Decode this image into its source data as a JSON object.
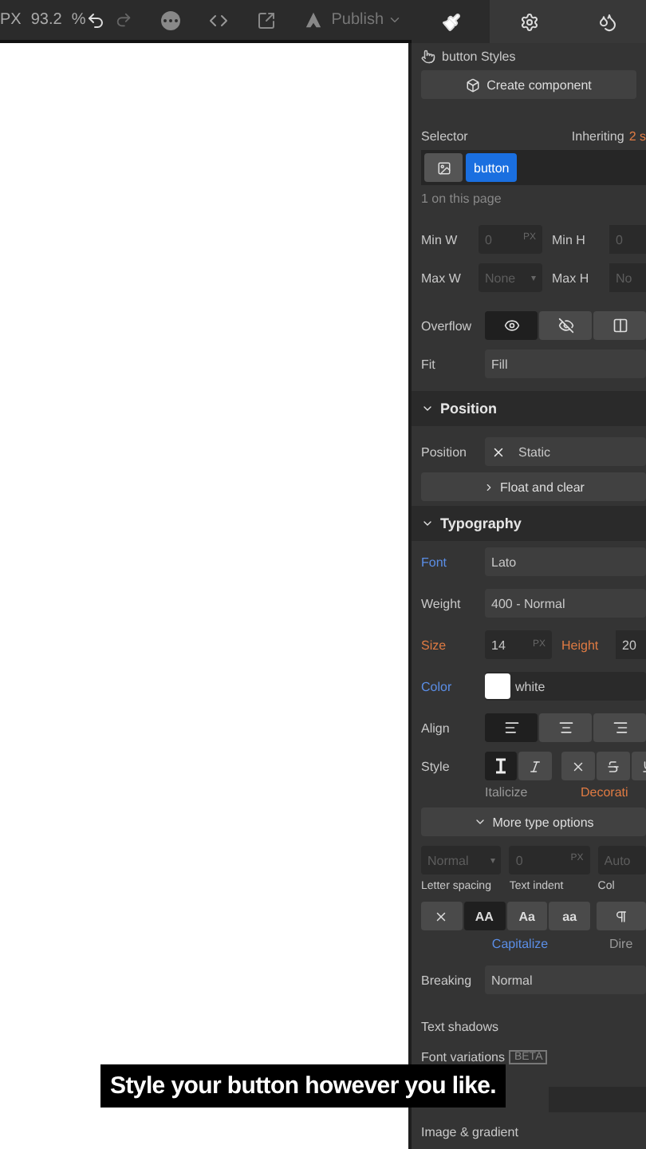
{
  "toolbar": {
    "unit": "PX",
    "zoom": "93.2",
    "percent": "%",
    "publish": "Publish"
  },
  "panel_tabs": [
    {
      "kind": "style",
      "selected": true
    },
    {
      "kind": "settings",
      "selected": false
    },
    {
      "kind": "interactions",
      "selected": false
    }
  ],
  "styles_header": "button Styles",
  "create_component": "Create component",
  "selector": {
    "label": "Selector",
    "inheriting": "Inheriting",
    "inheriting_count": "2 s",
    "tag": "button",
    "usage": "1 on this page"
  },
  "size_rows": [
    {
      "label": "Min W",
      "placeholder": "0",
      "unit": "PX",
      "label2": "Min H",
      "placeholder2": "0"
    },
    {
      "label": "Max W",
      "placeholder": "None",
      "unit": "▾",
      "label2": "Max H",
      "placeholder2": "No"
    }
  ],
  "overflow": {
    "label": "Overflow",
    "options": [
      {
        "kind": "visible",
        "selected": true
      },
      {
        "kind": "hidden",
        "selected": false
      },
      {
        "kind": "scroll",
        "selected": false
      }
    ]
  },
  "fit": {
    "label": "Fit",
    "value": "Fill"
  },
  "position_section": {
    "title": "Position",
    "expanded": true,
    "label": "Position",
    "value": "Static",
    "float": "Float and clear"
  },
  "typography": {
    "title": "Typography",
    "expanded": true,
    "rows": [
      {
        "kind": "select",
        "label": "Font",
        "color": "#5b8ee6",
        "value": "Lato"
      },
      {
        "kind": "select",
        "label": "Weight",
        "value": "400 - Normal"
      },
      {
        "kind": "size",
        "label": "Size",
        "color": "#e07b43",
        "value": "14",
        "unit": "PX",
        "second": {
          "label": "Height",
          "color": "#e07b43",
          "value": "20"
        }
      },
      {
        "kind": "color",
        "label": "Color",
        "color": "#5b8ee6",
        "value": "white",
        "swatch": {
          "color": "#ffffff"
        }
      }
    ],
    "align": {
      "label": "Align",
      "options": [
        {
          "kind": "left",
          "selected": true
        },
        {
          "kind": "center",
          "selected": false
        },
        {
          "kind": "right",
          "selected": false
        }
      ]
    },
    "style": {
      "label": "Style",
      "italic": [
        {
          "kind": "regular",
          "selected": true
        },
        {
          "kind": "italic",
          "selected": false
        }
      ],
      "decoration": [
        {
          "kind": "none",
          "selected": false
        },
        {
          "kind": "strike",
          "selected": false
        },
        {
          "kind": "underline",
          "selected": false
        }
      ],
      "caption1": "Italicize",
      "caption2": "Decorati"
    },
    "more": "More type options",
    "spacing": [
      {
        "placeholder": "Normal",
        "unit": "▾",
        "caption": "Letter spacing"
      },
      {
        "placeholder": "0",
        "unit": "PX",
        "caption": "Text indent"
      },
      {
        "placeholder": "Auto",
        "caption": "Col"
      }
    ],
    "transform": [
      {
        "kind": "none",
        "selected": false
      },
      {
        "kind": "text",
        "text": "AA",
        "selected": true
      },
      {
        "kind": "text",
        "text": "Aa",
        "selected": false
      },
      {
        "kind": "text",
        "text": "aa",
        "selected": false
      }
    ],
    "transform_caption": "Capitalize",
    "direction_caption": "Dire",
    "breaking": {
      "label": "Breaking",
      "value": "Normal"
    },
    "text_shadows": "Text shadows",
    "font_variations": "Font variations",
    "beta": "BETA"
  },
  "image_gradient": "Image & gradient",
  "caption": "Style your button however you like."
}
